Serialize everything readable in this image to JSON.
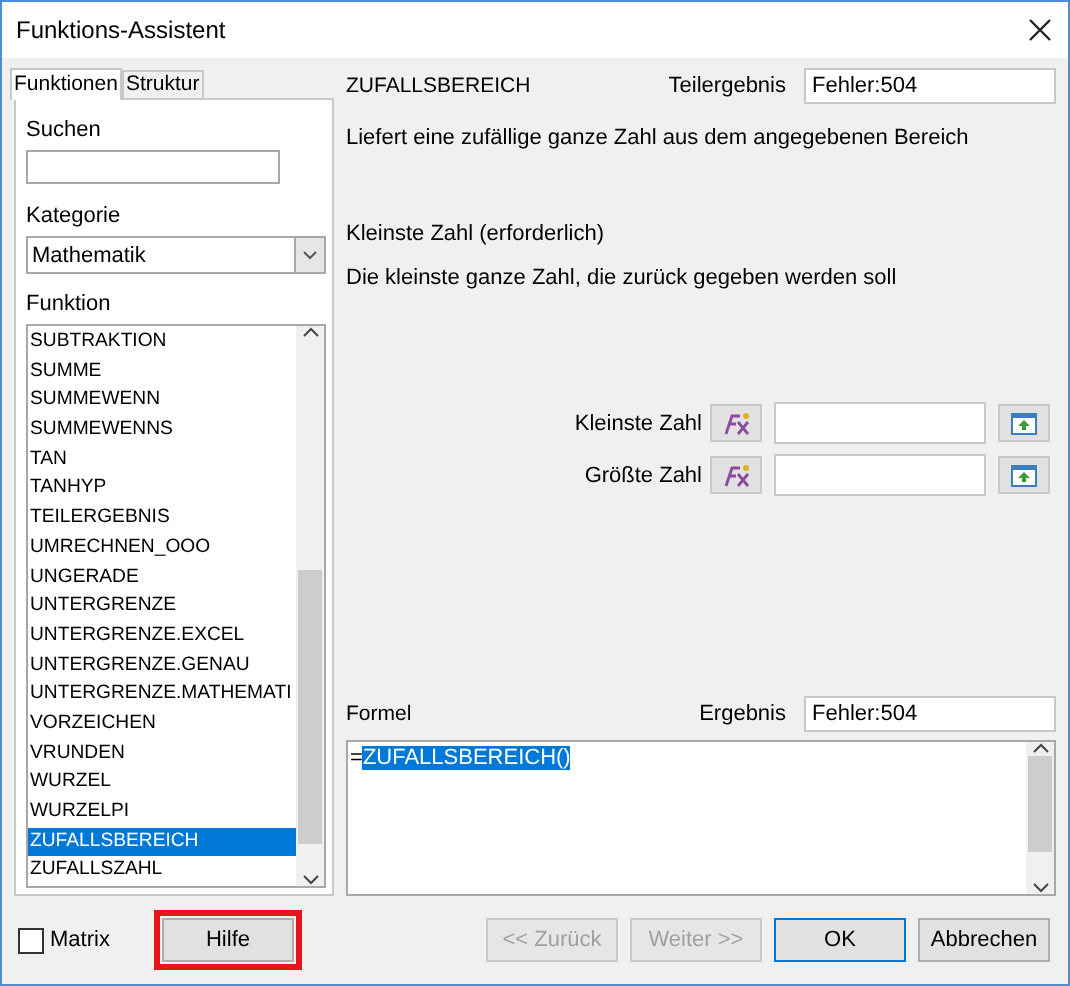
{
  "window": {
    "title": "Funktions-Assistent"
  },
  "tabs": [
    {
      "label": "Funktionen",
      "selected": true
    },
    {
      "label": "Struktur",
      "selected": false
    }
  ],
  "search": {
    "label": "Suchen"
  },
  "category": {
    "label": "Kategorie",
    "value": "Mathematik"
  },
  "function_list": {
    "label": "Funktion",
    "items": [
      {
        "label": "SUBTRAKTION",
        "selected": false
      },
      {
        "label": "SUMME",
        "selected": false
      },
      {
        "label": "SUMMEWENN",
        "selected": false
      },
      {
        "label": "SUMMEWENNS",
        "selected": false
      },
      {
        "label": "TAN",
        "selected": false
      },
      {
        "label": "TANHYP",
        "selected": false
      },
      {
        "label": "TEILERGEBNIS",
        "selected": false
      },
      {
        "label": "UMRECHNEN_OOO",
        "selected": false
      },
      {
        "label": "UNGERADE",
        "selected": false
      },
      {
        "label": "UNTERGRENZE",
        "selected": false
      },
      {
        "label": "UNTERGRENZE.EXCEL",
        "selected": false
      },
      {
        "label": "UNTERGRENZE.GENAU",
        "selected": false
      },
      {
        "label": "UNTERGRENZE.MATHEMATI",
        "selected": false
      },
      {
        "label": "VORZEICHEN",
        "selected": false
      },
      {
        "label": "VRUNDEN",
        "selected": false
      },
      {
        "label": "WURZEL",
        "selected": false
      },
      {
        "label": "WURZELPI",
        "selected": false
      },
      {
        "label": "ZUFALLSBEREICH",
        "selected": true
      },
      {
        "label": "ZUFALLSZAHL",
        "selected": false
      }
    ]
  },
  "function_name": "ZUFALLSBEREICH",
  "partial_result": {
    "label": "Teilergebnis",
    "value": "Fehler:504"
  },
  "description": "Liefert eine zufällige ganze Zahl aus dem angegebenen Bereich",
  "argument_title": "Kleinste Zahl (erforderlich)",
  "argument_description": "Die kleinste ganze Zahl, die zurück gegeben werden soll",
  "arguments": [
    {
      "label": "Kleinste Zahl"
    },
    {
      "label": "Größte Zahl"
    }
  ],
  "formula": {
    "label": "Formel",
    "prefix": "=",
    "selected_text": "ZUFALLSBEREICH()"
  },
  "result": {
    "label": "Ergebnis",
    "value": "Fehler:504"
  },
  "matrix": {
    "label": "Matrix",
    "checked": false
  },
  "buttons": [
    {
      "label": "Hilfe",
      "kind": "help",
      "disabled": false,
      "highlighted": true
    },
    {
      "label": "<< Zurück",
      "kind": "nav",
      "disabled": true
    },
    {
      "label": "Weiter >>",
      "kind": "nav",
      "disabled": true
    },
    {
      "label": "OK",
      "kind": "default",
      "disabled": false
    },
    {
      "label": "Abbrechen",
      "kind": "nav",
      "disabled": false
    }
  ]
}
